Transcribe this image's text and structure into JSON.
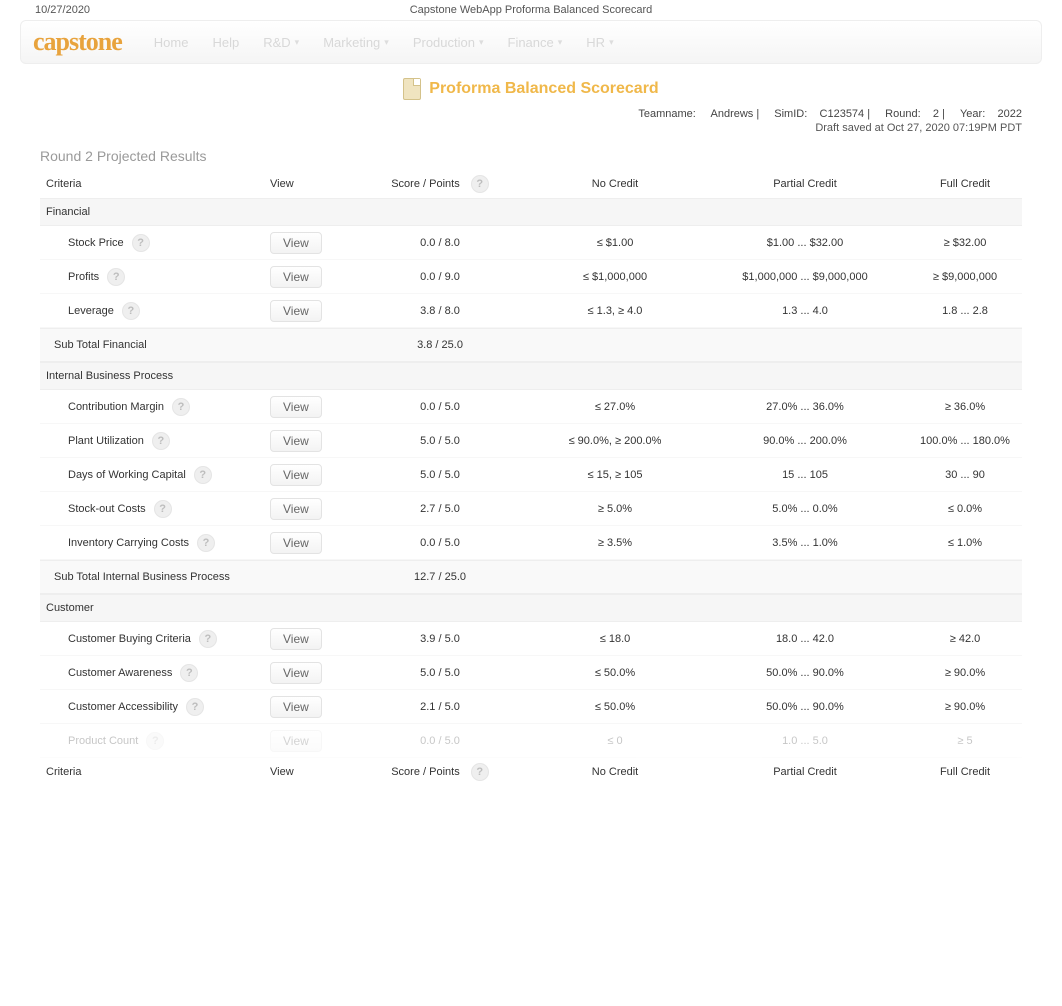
{
  "top": {
    "date": "10/27/2020",
    "title": "Capstone WebApp Proforma Balanced Scorecard"
  },
  "nav": {
    "logo": "capstone",
    "items": [
      "Home",
      "Help",
      "R&D",
      "Marketing",
      "Production",
      "Finance",
      "HR"
    ]
  },
  "doc_title": "Proforma Balanced Scorecard",
  "meta": {
    "team_label": "Teamname:",
    "team_value": "Andrews",
    "sim_label": "SimID:",
    "sim_value": "C123574",
    "round_label": "Round:",
    "round_value": "2",
    "year_label": "Year:",
    "year_value": "2022",
    "draft": "Draft saved at Oct 27, 2020 07:19PM PDT"
  },
  "section_title": "Round 2 Projected Results",
  "headers": {
    "criteria": "Criteria",
    "view": "View",
    "score": "Score / Points",
    "nc": "No Credit",
    "pc": "Partial Credit",
    "fc": "Full Credit"
  },
  "view_label": "View",
  "groups": [
    {
      "name": "Financial",
      "rows": [
        {
          "criteria": "Stock Price",
          "score": "0.0  / 8.0",
          "nc": "≤ $1.00",
          "pc": "$1.00 ... $32.00",
          "fc": "≥ $32.00"
        },
        {
          "criteria": "Profits",
          "score": "0.0  / 9.0",
          "nc": "≤ $1,000,000",
          "pc": "$1,000,000 ... $9,000,000",
          "fc": "≥ $9,000,000"
        },
        {
          "criteria": "Leverage",
          "score": "3.8  / 8.0",
          "nc": "≤ 1.3, ≥ 4.0",
          "pc": "1.3 ... 4.0",
          "fc": "1.8 ... 2.8"
        }
      ],
      "subtotal": {
        "label": "Sub Total Financial",
        "score": "3.8   / 25.0"
      }
    },
    {
      "name": "Internal Business Process",
      "rows": [
        {
          "criteria": "Contribution Margin",
          "score": "0.0  / 5.0",
          "nc": "≤ 27.0%",
          "pc": "27.0% ... 36.0%",
          "fc": "≥ 36.0%"
        },
        {
          "criteria": "Plant Utilization",
          "score": "5.0 / 5.0",
          "nc": "≤ 90.0%, ≥ 200.0%",
          "pc": "90.0% ... 200.0%",
          "fc": "100.0% ... 180.0%"
        },
        {
          "criteria": "Days of Working Capital",
          "score": "5.0 / 5.0",
          "nc": "≤ 15, ≥ 105",
          "pc": "15 ... 105",
          "fc": "30 ... 90"
        },
        {
          "criteria": "Stock-out Costs",
          "score": "2.7  / 5.0",
          "nc": "≥ 5.0%",
          "pc": "5.0% ... 0.0%",
          "fc": "≤ 0.0%"
        },
        {
          "criteria": "Inventory Carrying Costs",
          "score": "0.0  / 5.0",
          "nc": "≥ 3.5%",
          "pc": "3.5% ... 1.0%",
          "fc": "≤ 1.0%"
        }
      ],
      "subtotal": {
        "label": "Sub Total Internal Business Process",
        "score": "12.7   / 25.0"
      }
    },
    {
      "name": "Customer",
      "rows": [
        {
          "criteria": "Customer Buying Criteria",
          "score": "3.9 / 5.0",
          "nc": "≤ 18.0",
          "pc": "18.0 ... 42.0",
          "fc": "≥ 42.0"
        },
        {
          "criteria": "Customer Awareness",
          "score": "5.0 / 5.0",
          "nc": "≤ 50.0%",
          "pc": "50.0% ... 90.0%",
          "fc": "≥ 90.0%"
        },
        {
          "criteria": "Customer Accessibility",
          "score": "2.1  / 5.0",
          "nc": "≤ 50.0%",
          "pc": "50.0% ... 90.0%",
          "fc": "≥ 90.0%"
        }
      ]
    }
  ],
  "faded_row": {
    "criteria": "Product Count",
    "score": "0.0  / 5.0",
    "nc": "≤ 0",
    "pc": "1.0 ... 5.0",
    "fc": "≥ 5"
  }
}
